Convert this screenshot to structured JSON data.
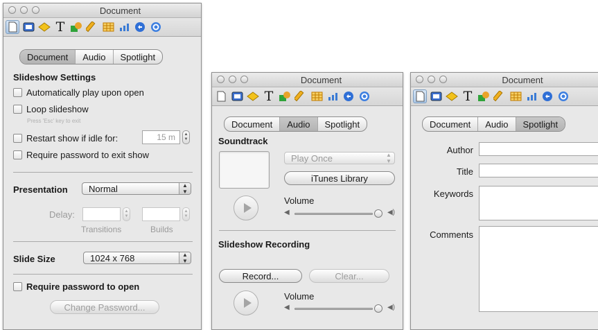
{
  "windows": [
    {
      "title": "Document",
      "tabs": [
        "Document",
        "Audio",
        "Spotlight"
      ],
      "active_tab": "Document"
    },
    {
      "title": "Document",
      "tabs": [
        "Document",
        "Audio",
        "Spotlight"
      ],
      "active_tab": "Audio"
    },
    {
      "title": "Document",
      "tabs": [
        "Document",
        "Audio",
        "Spotlight"
      ],
      "active_tab": "Spotlight"
    }
  ],
  "toolbar_icons": [
    "document-inspector-icon",
    "slide-inspector-icon",
    "build-inspector-icon",
    "text-inspector-icon",
    "graphic-inspector-icon",
    "metrics-inspector-icon",
    "table-inspector-icon",
    "chart-inspector-icon",
    "hyperlink-inspector-icon",
    "quicktime-inspector-icon"
  ],
  "document_panel": {
    "slideshow_header": "Slideshow Settings",
    "autoplay": "Automatically play upon open",
    "loop": "Loop slideshow",
    "loop_hint": "Press 'Esc' key to exit",
    "restart": "Restart show if idle for:",
    "restart_value": "15 m",
    "require_exit": "Require password to exit show",
    "presentation_label": "Presentation",
    "presentation_value": "Normal",
    "delay_label": "Delay:",
    "transitions_label": "Transitions",
    "builds_label": "Builds",
    "slide_size_label": "Slide Size",
    "slide_size_value": "1024 x 768",
    "require_open": "Require password to open",
    "change_password": "Change Password..."
  },
  "audio_panel": {
    "soundtrack_header": "Soundtrack",
    "play_mode": "Play Once",
    "itunes_button": "iTunes Library",
    "volume_label": "Volume",
    "recording_header": "Slideshow Recording",
    "record_button": "Record...",
    "clear_button": "Clear...",
    "volume_label_2": "Volume"
  },
  "spotlight_panel": {
    "author_label": "Author",
    "title_label": "Title",
    "keywords_label": "Keywords",
    "comments_label": "Comments"
  }
}
